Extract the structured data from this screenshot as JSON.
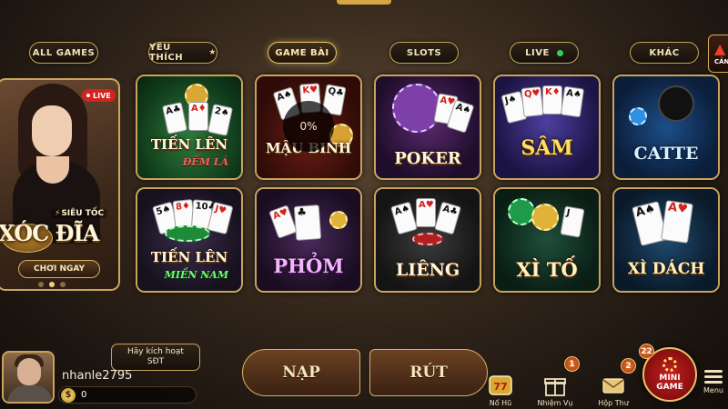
{
  "tabs": [
    {
      "label": "ALL GAMES"
    },
    {
      "label": "YÊU THÍCH"
    },
    {
      "label": "GAME BÀI"
    },
    {
      "label": "SLOTS"
    },
    {
      "label": "LIVE"
    },
    {
      "label": "KHÁC"
    }
  ],
  "cancel_label": "CẢN",
  "banner": {
    "live_label": "LIVE",
    "tag": "SIÊU TỐC",
    "title": "XÓC ĐĨA",
    "play_label": "CHƠI NGAY"
  },
  "games": [
    {
      "title": "TIẾN LÊN",
      "subtitle": "ĐẾM LÁ"
    },
    {
      "title": "MẬU BINH",
      "subtitle": ""
    },
    {
      "title": "POKER",
      "subtitle": ""
    },
    {
      "title": "SÂM",
      "subtitle": ""
    },
    {
      "title": "CATTE",
      "subtitle": ""
    },
    {
      "title": "TIẾN LÊN",
      "subtitle": "MIỀN NAM"
    },
    {
      "title": "PHỎM",
      "subtitle": ""
    },
    {
      "title": "LIÊNG",
      "subtitle": ""
    },
    {
      "title": "XÌ TỐ",
      "subtitle": ""
    },
    {
      "title": "XÌ DÁCH",
      "subtitle": ""
    }
  ],
  "loading_text": "0%",
  "user": {
    "activate_line1": "Hãy kích hoạt",
    "activate_line2": "SĐT",
    "username": "nhanle2795",
    "currency_symbol": "$",
    "balance": "0"
  },
  "actions": {
    "deposit": "NẠP",
    "withdraw": "RÚT"
  },
  "nav": {
    "jackpot": {
      "label": "Nổ Hũ",
      "icon": "slot-777-icon"
    },
    "missions": {
      "label": "Nhiệm Vụ",
      "icon": "gift-icon",
      "badge": "1"
    },
    "inbox": {
      "label": "Hộp Thư",
      "icon": "mail-icon",
      "badge": "2"
    },
    "mini_game": {
      "line1": "MINI",
      "line2": "GAME",
      "badge": "22"
    },
    "menu": {
      "label": "Menu",
      "icon": "menu-icon"
    }
  },
  "colors": {
    "gold": "#c9a35c",
    "live_red": "#d3231e",
    "live_green": "#35d05a",
    "badge_orange": "#e8722a"
  }
}
